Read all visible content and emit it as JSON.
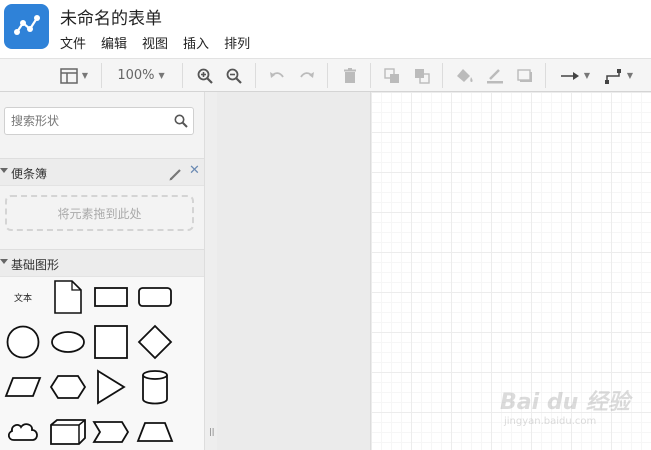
{
  "app": {
    "title": "未命名的表单",
    "logo_icon": "diagram-logo-icon",
    "brand_color": "#2f82d8"
  },
  "menu": [
    "文件",
    "编辑",
    "视图",
    "插入",
    "排列"
  ],
  "toolbar": {
    "zoom": "100%",
    "icons": [
      "format-panel-icon",
      "zoom-in-icon",
      "zoom-out-icon",
      "undo-icon",
      "redo-icon",
      "delete-icon",
      "to-front-icon",
      "to-back-icon",
      "fill-color-icon",
      "line-color-icon",
      "shadow-icon",
      "connection-arrow-icon",
      "waypoint-style-icon"
    ]
  },
  "sidebar": {
    "search": {
      "placeholder": "搜索形状",
      "value": ""
    },
    "scratchpad": {
      "title": "便条簿",
      "drop_hint": "将元素拖到此处"
    },
    "general": {
      "title": "基础图形",
      "text_shape_label": "文本",
      "shapes": [
        "text",
        "note",
        "rectangle",
        "rounded-rectangle",
        "circle",
        "ellipse",
        "square",
        "diamond",
        "parallelogram",
        "hexagon",
        "triangle",
        "cylinder",
        "cloud",
        "cube",
        "step",
        "trapezoid"
      ]
    }
  },
  "watermark": {
    "main": "Bai du 经验",
    "sub": "jingyan.baidu.com"
  }
}
